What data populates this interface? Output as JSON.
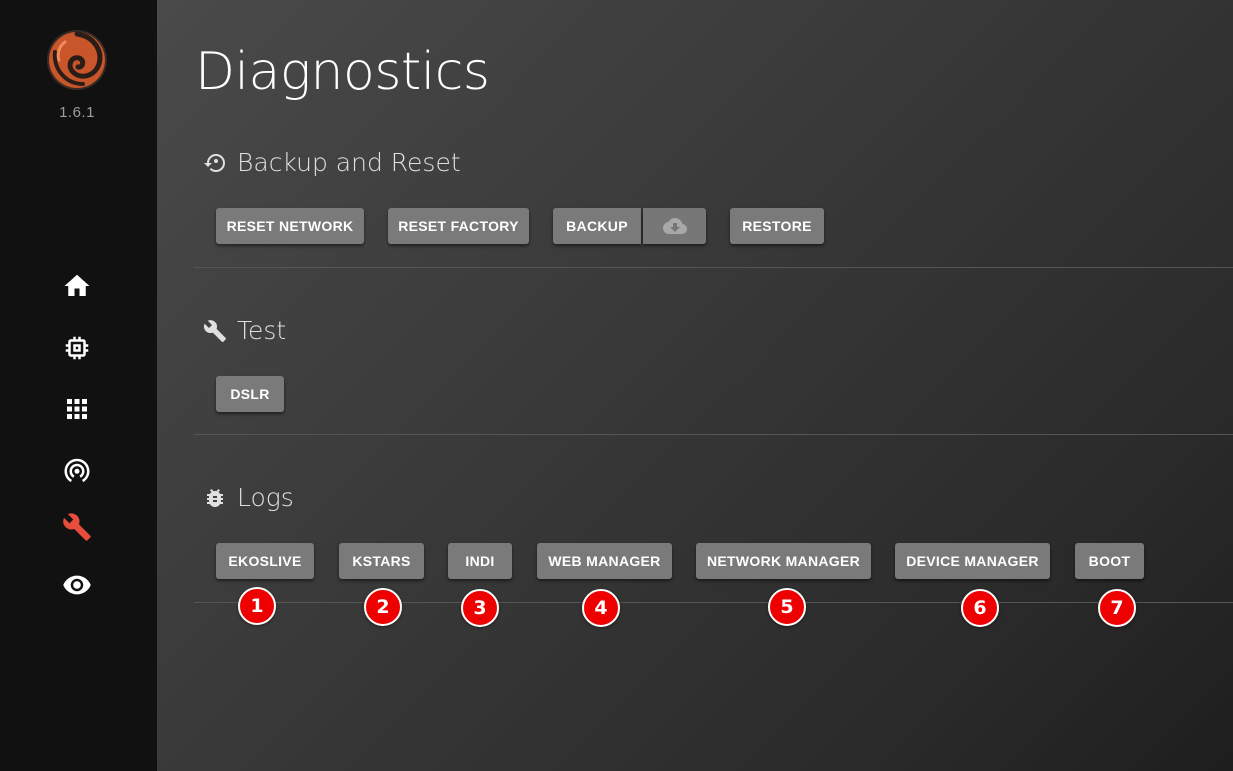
{
  "app": {
    "version": "1.6.1"
  },
  "sidebar": {
    "items": [
      {
        "name": "home",
        "icon": "home-icon",
        "active": false
      },
      {
        "name": "devices",
        "icon": "chip-icon",
        "active": false
      },
      {
        "name": "apps",
        "icon": "grid-icon",
        "active": false
      },
      {
        "name": "network",
        "icon": "wifi-tethering-icon",
        "active": false
      },
      {
        "name": "diagnostics",
        "icon": "wrench-icon",
        "active": true
      },
      {
        "name": "view",
        "icon": "eye-icon",
        "active": false
      }
    ],
    "active_color": "#e74c3c"
  },
  "page": {
    "title": "Diagnostics"
  },
  "sections": {
    "backup": {
      "title": "Backup and Reset",
      "icon": "restore-icon",
      "buttons": {
        "reset_network": "RESET NETWORK",
        "reset_factory": "RESET FACTORY",
        "backup": "BACKUP",
        "backup_download_icon": "cloud-download-icon",
        "restore": "RESTORE"
      }
    },
    "test": {
      "title": "Test",
      "icon": "wrench-icon",
      "buttons": {
        "dslr": "DSLR"
      }
    },
    "logs": {
      "title": "Logs",
      "icon": "bug-icon",
      "buttons": [
        {
          "label": "EKOSLIVE",
          "badge": "1"
        },
        {
          "label": "KSTARS",
          "badge": "2"
        },
        {
          "label": "INDI",
          "badge": "3"
        },
        {
          "label": "WEB MANAGER",
          "badge": "4"
        },
        {
          "label": "NETWORK MANAGER",
          "badge": "5"
        },
        {
          "label": "DEVICE MANAGER",
          "badge": "6"
        },
        {
          "label": "BOOT",
          "badge": "7"
        }
      ]
    }
  },
  "colors": {
    "button_bg": "#7a7a7a",
    "badge_bg": "#ee0000",
    "logo_orange": "#d35a2b"
  }
}
